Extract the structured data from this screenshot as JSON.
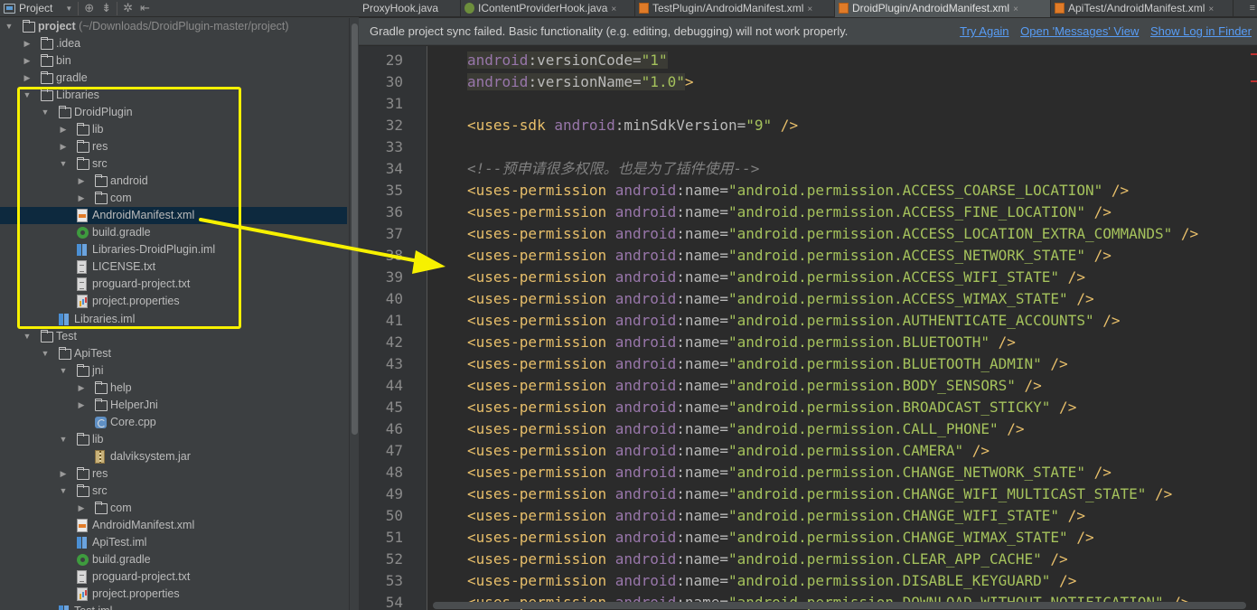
{
  "panel_header": {
    "title": "Project",
    "icons": [
      "project-icon",
      "dropdown-caret",
      "sync-icon",
      "collapse-icon",
      "settings-icon",
      "hide-icon"
    ]
  },
  "tree": [
    {
      "label": "project",
      "hint": "(~/Downloads/DroidPlugin-master/project)",
      "icon": "folder",
      "arrow": "down",
      "level": 0,
      "bold": true
    },
    {
      "label": ".idea",
      "icon": "folder",
      "arrow": "right",
      "level": 1
    },
    {
      "label": "bin",
      "icon": "folder",
      "arrow": "right",
      "level": 1
    },
    {
      "label": "gradle",
      "icon": "folder",
      "arrow": "right",
      "level": 1
    },
    {
      "label": "Libraries",
      "icon": "folder",
      "arrow": "down",
      "level": 1
    },
    {
      "label": "DroidPlugin",
      "icon": "folder",
      "arrow": "down",
      "level": 2
    },
    {
      "label": "lib",
      "icon": "folder",
      "arrow": "right",
      "level": 3
    },
    {
      "label": "res",
      "icon": "folder",
      "arrow": "right",
      "level": 3
    },
    {
      "label": "src",
      "icon": "folder",
      "arrow": "down",
      "level": 3
    },
    {
      "label": "android",
      "icon": "folder",
      "arrow": "right",
      "level": 4
    },
    {
      "label": "com",
      "icon": "folder",
      "arrow": "right",
      "level": 4
    },
    {
      "label": "AndroidManifest.xml",
      "icon": "xml",
      "arrow": "",
      "level": 3,
      "selected": true
    },
    {
      "label": "build.gradle",
      "icon": "gradle",
      "arrow": "",
      "level": 3
    },
    {
      "label": "Libraries-DroidPlugin.iml",
      "icon": "iml",
      "arrow": "",
      "level": 3
    },
    {
      "label": "LICENSE.txt",
      "icon": "txt",
      "arrow": "",
      "level": 3
    },
    {
      "label": "proguard-project.txt",
      "icon": "txt",
      "arrow": "",
      "level": 3
    },
    {
      "label": "project.properties",
      "icon": "props",
      "arrow": "",
      "level": 3
    },
    {
      "label": "Libraries.iml",
      "icon": "iml",
      "arrow": "",
      "level": 2
    },
    {
      "label": "Test",
      "icon": "folder",
      "arrow": "down",
      "level": 1
    },
    {
      "label": "ApiTest",
      "icon": "folder",
      "arrow": "down",
      "level": 2
    },
    {
      "label": "jni",
      "icon": "folder",
      "arrow": "down",
      "level": 3
    },
    {
      "label": "help",
      "icon": "folder",
      "arrow": "right",
      "level": 4
    },
    {
      "label": "HelperJni",
      "icon": "folder",
      "arrow": "right",
      "level": 4
    },
    {
      "label": "Core.cpp",
      "icon": "cpp",
      "arrow": "",
      "level": 4
    },
    {
      "label": "lib",
      "icon": "folder",
      "arrow": "down",
      "level": 3
    },
    {
      "label": "dalviksystem.jar",
      "icon": "jar",
      "arrow": "",
      "level": 4
    },
    {
      "label": "res",
      "icon": "folder",
      "arrow": "right",
      "level": 3
    },
    {
      "label": "src",
      "icon": "folder",
      "arrow": "down",
      "level": 3
    },
    {
      "label": "com",
      "icon": "folder",
      "arrow": "right",
      "level": 4
    },
    {
      "label": "AndroidManifest.xml",
      "icon": "xml",
      "arrow": "",
      "level": 3
    },
    {
      "label": "ApiTest.iml",
      "icon": "iml",
      "arrow": "",
      "level": 3
    },
    {
      "label": "build.gradle",
      "icon": "gradle",
      "arrow": "",
      "level": 3
    },
    {
      "label": "proguard-project.txt",
      "icon": "txt",
      "arrow": "",
      "level": 3
    },
    {
      "label": "project.properties",
      "icon": "props",
      "arrow": "",
      "level": 3
    },
    {
      "label": "Test.iml",
      "icon": "iml",
      "arrow": "",
      "level": 2
    }
  ],
  "tabs": [
    {
      "label": "ProxyHook.java",
      "icon": "class",
      "active": false
    },
    {
      "label": "IContentProviderHook.java",
      "icon": "interface",
      "active": false
    },
    {
      "label": "TestPlugin/AndroidManifest.xml",
      "icon": "xml",
      "active": false
    },
    {
      "label": "DroidPlugin/AndroidManifest.xml",
      "icon": "xml",
      "active": true
    },
    {
      "label": "ApiTest/AndroidManifest.xml",
      "icon": "xml",
      "active": false
    }
  ],
  "tab_overflow": "≡",
  "notification": {
    "message": "Gradle project sync failed. Basic functionality (e.g. editing, debugging) will not work properly.",
    "links": [
      "Try Again",
      "Open 'Messages' View",
      "Show Log in Finder"
    ]
  },
  "editor": {
    "lines": [
      {
        "n": "29",
        "tokens": [
          [
            "ns",
            "android"
          ],
          [
            "attr",
            ":versionCode="
          ],
          [
            "str",
            "\"1\""
          ]
        ],
        "indent": 2,
        "hl": true
      },
      {
        "n": "30",
        "tokens": [
          [
            "ns",
            "android"
          ],
          [
            "attr",
            ":versionName="
          ],
          [
            "str",
            "\"1.0\""
          ],
          [
            "tag",
            ">"
          ]
        ],
        "indent": 2,
        "hl": true
      },
      {
        "n": "31",
        "tokens": []
      },
      {
        "n": "32",
        "tokens": [
          [
            "tag",
            "<uses-sdk "
          ],
          [
            "ns",
            "android"
          ],
          [
            "attr",
            ":minSdkVersion="
          ],
          [
            "str",
            "\"9\""
          ],
          [
            "tag",
            " />"
          ]
        ]
      },
      {
        "n": "33",
        "tokens": []
      },
      {
        "n": "34",
        "tokens": [
          [
            "cmt",
            "<!--预申请很多权限。也是为了插件使用-->"
          ]
        ]
      },
      {
        "n": "35",
        "perm": "ACCESS_COARSE_LOCATION"
      },
      {
        "n": "36",
        "perm": "ACCESS_FINE_LOCATION"
      },
      {
        "n": "37",
        "perm": "ACCESS_LOCATION_EXTRA_COMMANDS"
      },
      {
        "n": "38",
        "perm": "ACCESS_NETWORK_STATE"
      },
      {
        "n": "39",
        "perm": "ACCESS_WIFI_STATE"
      },
      {
        "n": "40",
        "perm": "ACCESS_WIMAX_STATE"
      },
      {
        "n": "41",
        "perm": "AUTHENTICATE_ACCOUNTS"
      },
      {
        "n": "42",
        "perm": "BLUETOOTH"
      },
      {
        "n": "43",
        "perm": "BLUETOOTH_ADMIN"
      },
      {
        "n": "44",
        "perm": "BODY_SENSORS"
      },
      {
        "n": "45",
        "perm": "BROADCAST_STICKY"
      },
      {
        "n": "46",
        "perm": "CALL_PHONE"
      },
      {
        "n": "47",
        "perm": "CAMERA"
      },
      {
        "n": "48",
        "perm": "CHANGE_NETWORK_STATE"
      },
      {
        "n": "49",
        "perm": "CHANGE_WIFI_MULTICAST_STATE"
      },
      {
        "n": "50",
        "perm": "CHANGE_WIFI_STATE"
      },
      {
        "n": "51",
        "perm": "CHANGE_WIMAX_STATE"
      },
      {
        "n": "52",
        "perm": "CLEAR_APP_CACHE"
      },
      {
        "n": "53",
        "perm": "DISABLE_KEYGUARD"
      },
      {
        "n": "54",
        "perm": "DOWNLOAD_WITHOUT_NOTIFICATION"
      }
    ]
  },
  "colors": {
    "highlight_box": "#f7f100",
    "arrow": "#f7f100",
    "link": "#589df6",
    "selection": "#0d293e"
  }
}
